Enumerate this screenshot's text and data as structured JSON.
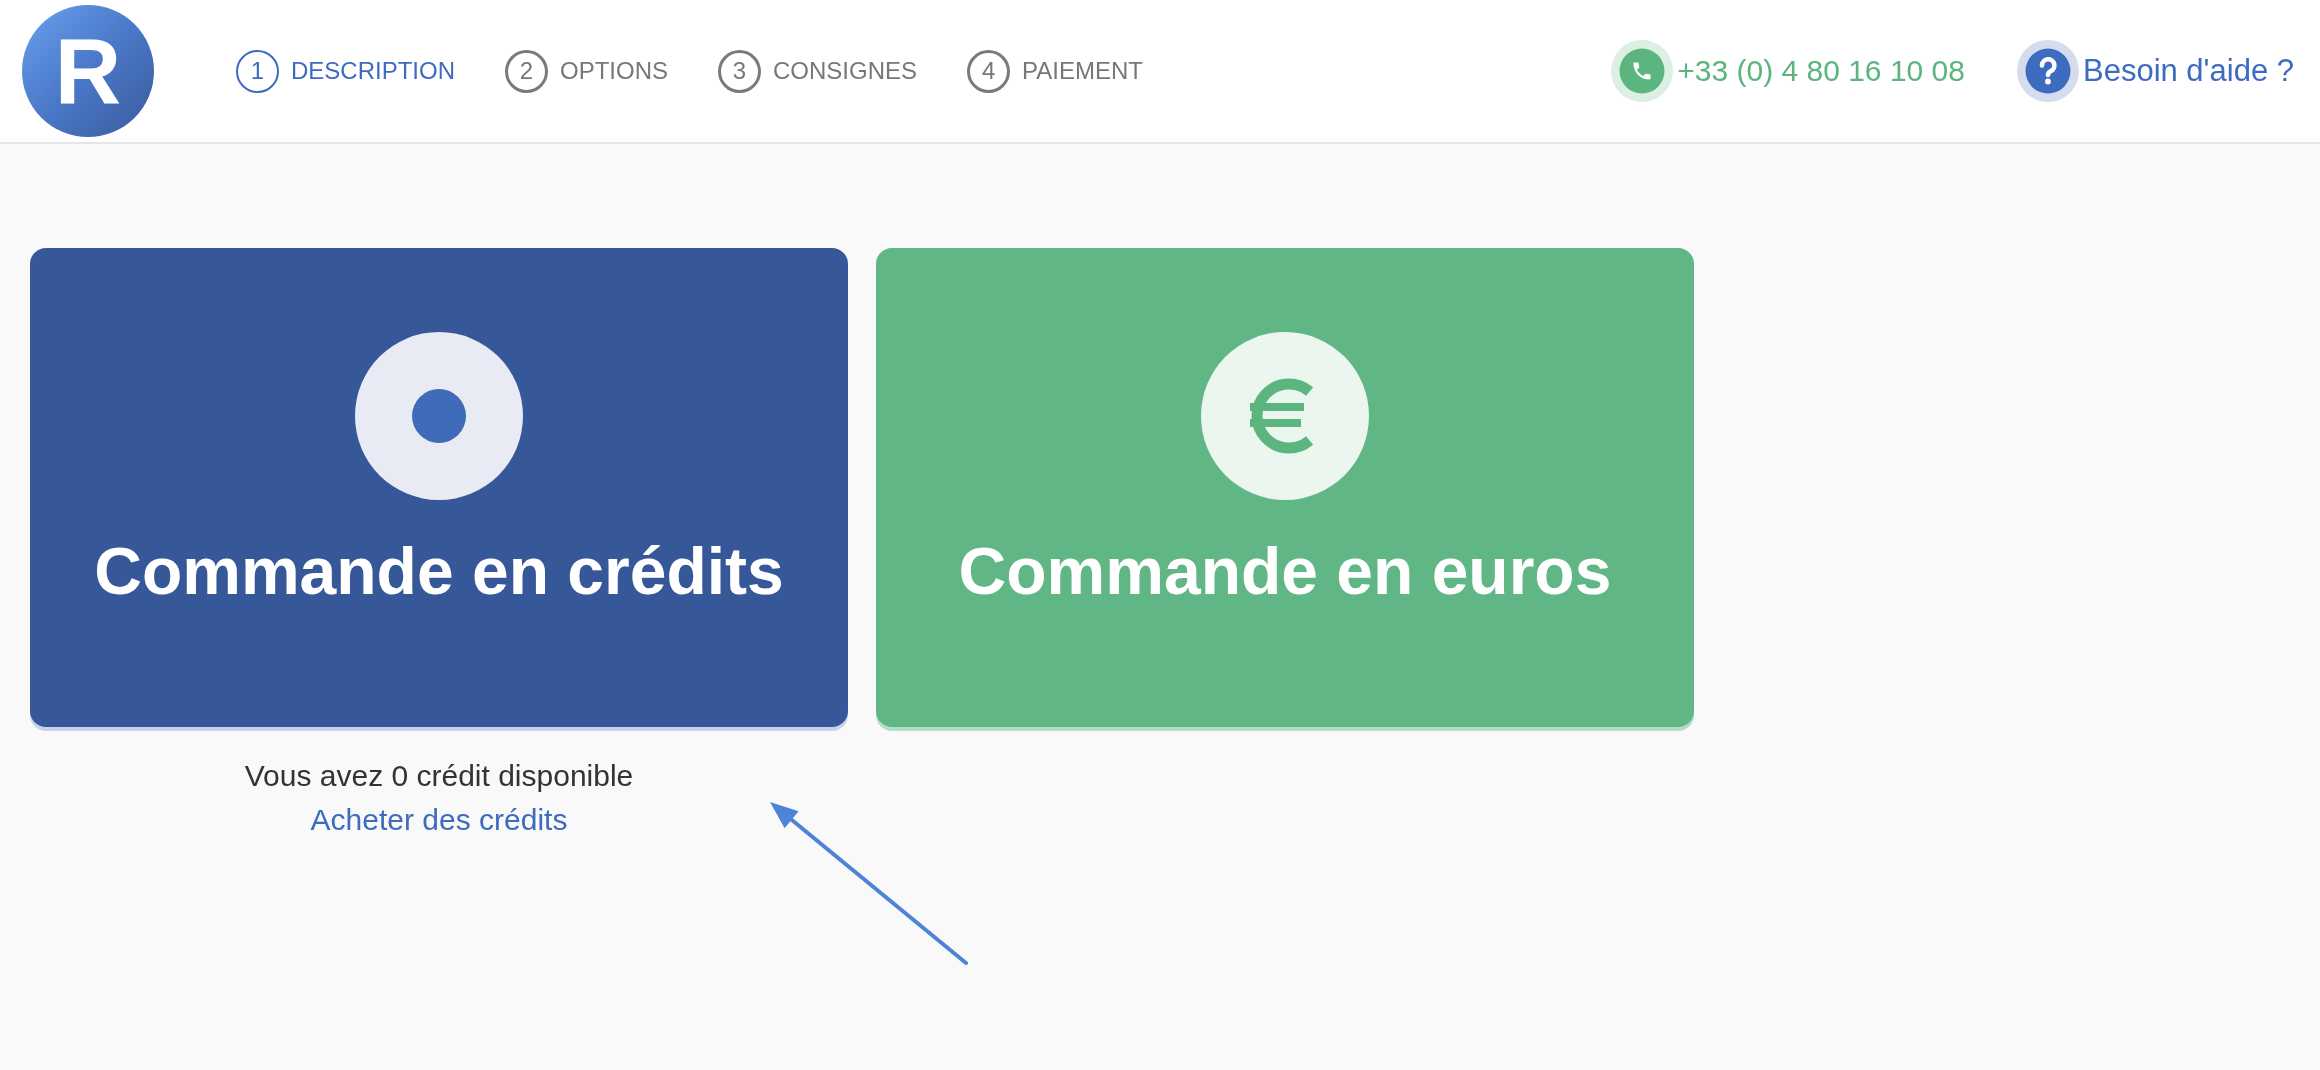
{
  "header": {
    "logo": "R",
    "steps": [
      {
        "number": "1",
        "label": "DESCRIPTION",
        "selected": true
      },
      {
        "number": "2",
        "label": "OPTIONS",
        "selected": false
      },
      {
        "number": "3",
        "label": "CONSIGNES",
        "selected": false
      },
      {
        "number": "4",
        "label": "PAIEMENT",
        "selected": false
      }
    ],
    "phone": "+33 (0) 4 80 16 10 08",
    "help": "Besoin d'aide ?"
  },
  "order_options": [
    {
      "kind": "credits",
      "title": "Commande en crédits",
      "balance": "Vous avez 0 crédit disponible",
      "link": "Acheter des crédits"
    },
    {
      "kind": "euros",
      "title": "Commande en euros"
    }
  ]
}
